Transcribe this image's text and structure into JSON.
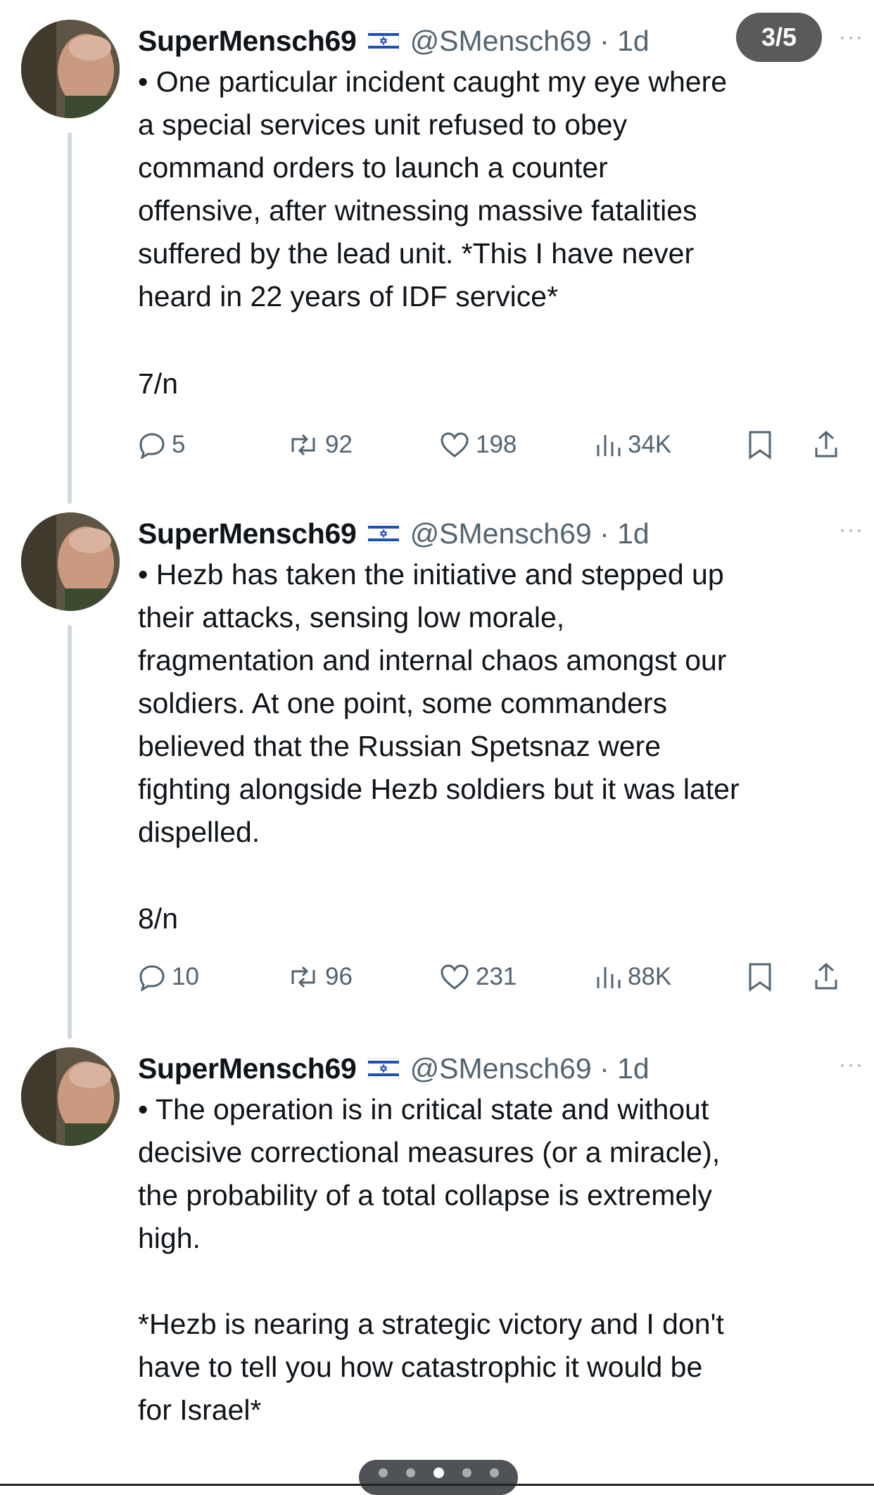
{
  "carousel": {
    "page_indicator": "3/5",
    "dots": 5,
    "active_dot": 3
  },
  "colors": {
    "text": "#0f1419",
    "secondary": "#536471",
    "thread_line": "#cfd9de",
    "badge_bg": "#5a5a5a"
  },
  "tweets": [
    {
      "author": "SuperMensch69",
      "flag_icon": "israel-flag-icon",
      "handle": "@SMensch69 · 1d",
      "more": "···",
      "text": "• One particular incident caught my eye where\na special services unit refused to obey\ncommand orders to launch a counter\noffensive, after witnessing massive fatalities\nsuffered by the lead unit. *This I have never\nheard in 22 years of IDF service*",
      "counter": "7/n",
      "replies": "5",
      "reposts": "92",
      "likes": "198",
      "views": "34K"
    },
    {
      "author": "SuperMensch69",
      "flag_icon": "israel-flag-icon",
      "handle": "@SMensch69 · 1d",
      "more": "···",
      "text": "• Hezb has taken the initiative and stepped up\ntheir attacks, sensing low morale,\nfragmentation and internal chaos amongst our\nsoldiers. At one point, some commanders\nbelieved that the Russian Spetsnaz were\nfighting alongside Hezb soldiers but it was later\ndispelled.",
      "counter": "8/n",
      "replies": "10",
      "reposts": "96",
      "likes": "231",
      "views": "88K"
    },
    {
      "author": "SuperMensch69",
      "flag_icon": "israel-flag-icon",
      "handle": "@SMensch69 · 1d",
      "more": "···",
      "text": "• The operation is in critical state and without\ndecisive correctional measures (or a miracle),\nthe probability of a total collapse is extremely\nhigh.\n\n*Hezb is nearing a strategic victory and I don't\nhave to tell you how catastrophic it would be\nfor Israel*"
    }
  ]
}
